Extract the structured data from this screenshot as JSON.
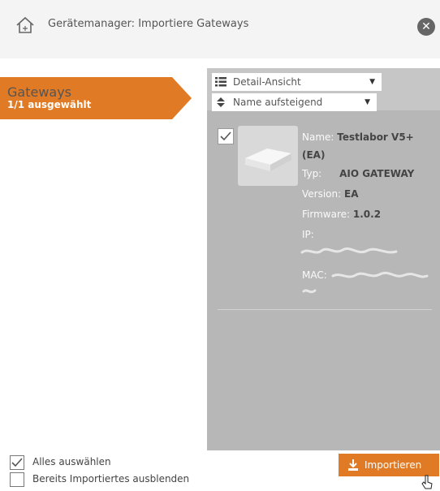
{
  "header": {
    "title": "Gerätemanager: Importiere Gateways",
    "home_icon": "home-icon",
    "close_icon": "close-icon"
  },
  "nav": {
    "label": "Gateways",
    "sublabel": "1/1 ausgewählt",
    "accent": "#e07a25"
  },
  "toolbar": {
    "view_select": {
      "icon": "list-icon",
      "value": "Detail-Ansicht"
    },
    "sort_select": {
      "icon": "sort-icon",
      "value": "Name aufsteigend"
    }
  },
  "device": {
    "checked": true,
    "name_label": "Name:",
    "name_value": "Testlabor V5+",
    "name_value_2": "(EA)",
    "type_label": "Typ:",
    "type_value": "AIO GATEWAY",
    "version_label": "Version:",
    "version_value": "EA",
    "firmware_label": "Firmware:",
    "firmware_value": "1.0.2",
    "ip_label": "IP:",
    "mac_label": "MAC:"
  },
  "footer": {
    "select_all": {
      "label": "Alles auswählen",
      "checked": true
    },
    "hide_imported": {
      "label": "Bereits Importiertes ausblenden",
      "checked": false
    },
    "import_button": "Importieren"
  }
}
